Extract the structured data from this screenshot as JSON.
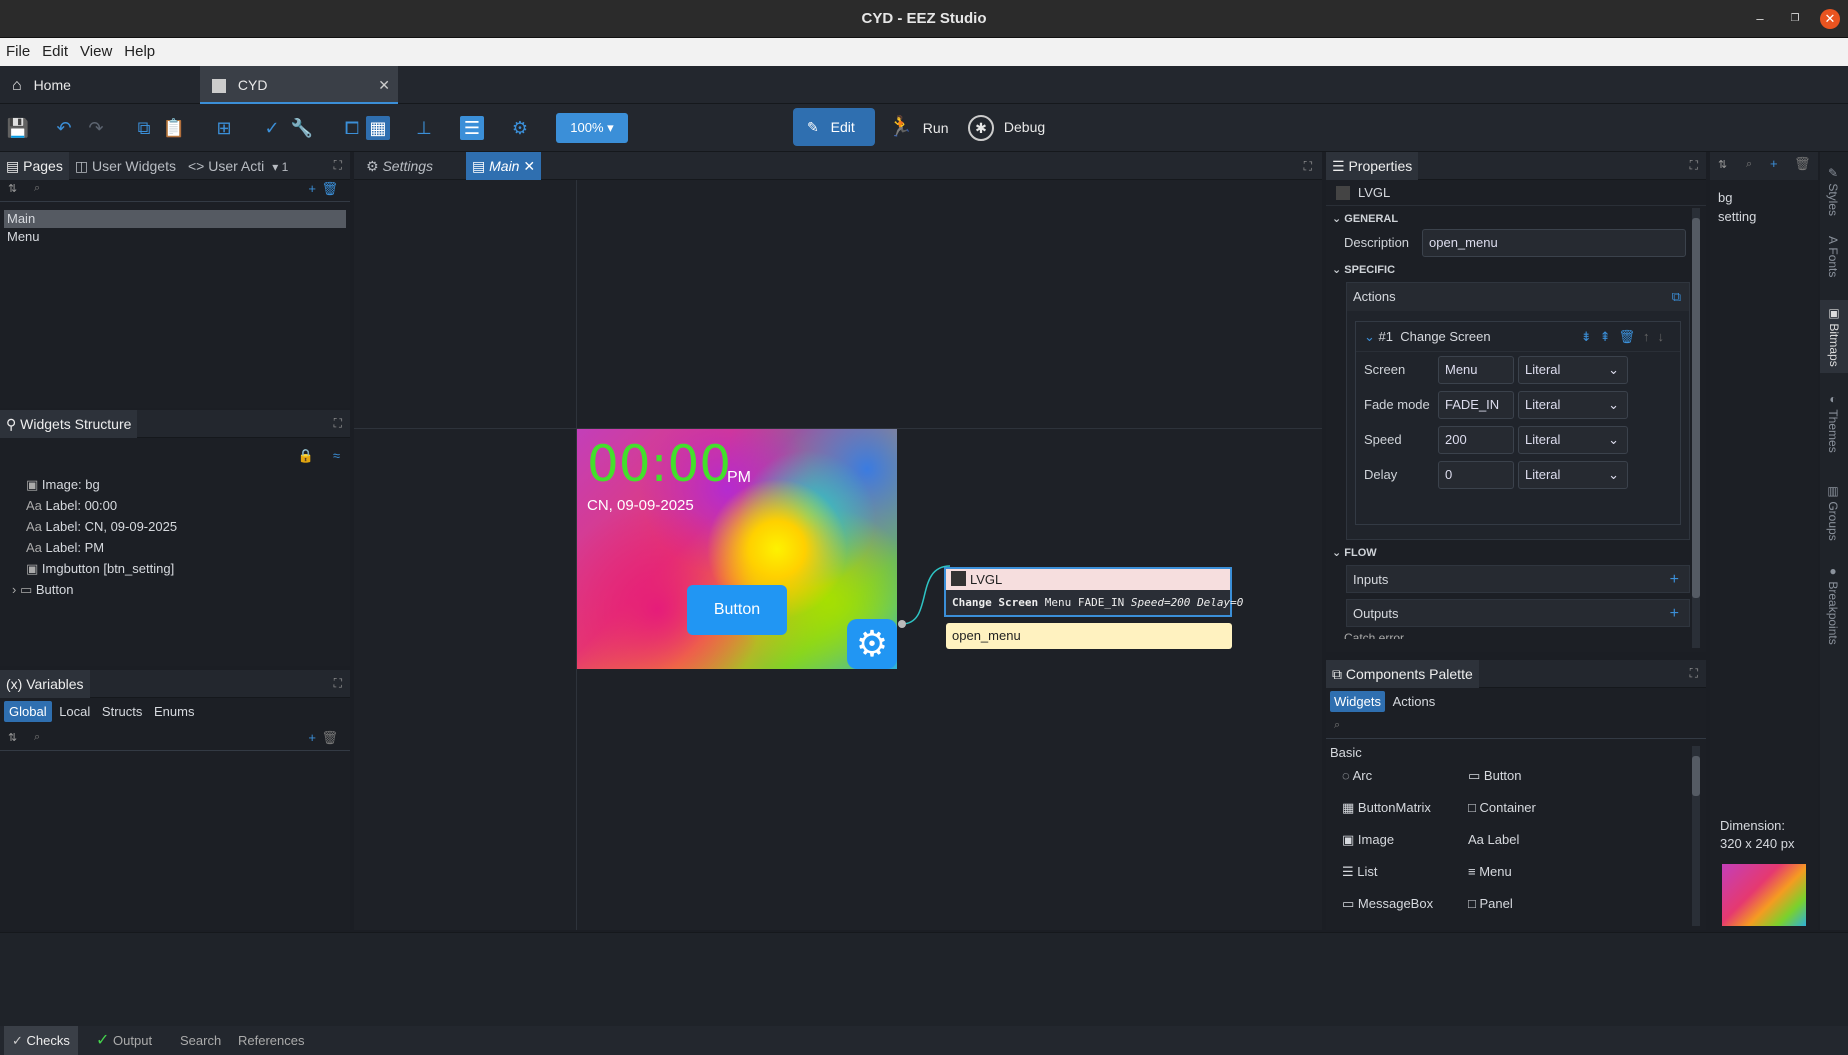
{
  "window": {
    "title": "CYD - EEZ Studio"
  },
  "menu": [
    "File",
    "Edit",
    "View",
    "Help"
  ],
  "tabs": {
    "home": "Home",
    "project": "CYD"
  },
  "toolbar": {
    "zoom": "100%",
    "edit": "Edit",
    "run": "Run",
    "debug": "Debug"
  },
  "left": {
    "tabs": [
      "Pages",
      "User Widgets",
      "User Acti"
    ],
    "tab_count": "1",
    "pages": [
      "Main",
      "Menu"
    ],
    "widgets_title": "Widgets Structure",
    "widgets": [
      "Image: bg",
      "Label: 00:00",
      "Label: CN, 09-09-2025",
      "Label: PM",
      "Imgbutton [btn_setting]",
      "Button"
    ],
    "vars_title": "Variables",
    "vars_prefix": "(x)",
    "vars_tabs": [
      "Global",
      "Local",
      "Structs",
      "Enums"
    ]
  },
  "editor": {
    "tabs": [
      "Settings",
      "Main"
    ],
    "screen": {
      "time": "00:00",
      "ampm": "PM",
      "date": "CN, 09-09-2025",
      "button": "Button"
    },
    "node": {
      "title": "LVGL",
      "body_bold": "Change Screen",
      "body_rest": "Menu FADE_IN",
      "speed": "Speed=200",
      "delay": "Delay=0",
      "description": "open_menu"
    }
  },
  "props": {
    "title": "Properties",
    "object": "LVGL",
    "general": "GENERAL",
    "description_label": "Description",
    "description": "open_menu",
    "specific": "SPECIFIC",
    "actions": "Actions",
    "action_num": "#1",
    "action_name": "Change Screen",
    "fields": [
      {
        "label": "Screen",
        "value": "Menu",
        "mode": "Literal"
      },
      {
        "label": "Fade mode",
        "value": "FADE_IN",
        "mode": "Literal"
      },
      {
        "label": "Speed",
        "value": "200",
        "mode": "Literal"
      },
      {
        "label": "Delay",
        "value": "0",
        "mode": "Literal"
      }
    ],
    "flow": "FLOW",
    "inputs": "Inputs",
    "outputs": "Outputs",
    "catch": "Catch error"
  },
  "palette": {
    "title": "Components Palette",
    "tabs": [
      "Widgets",
      "Actions"
    ],
    "section": "Basic",
    "items": [
      "Arc",
      "Button",
      "ButtonMatrix",
      "Container",
      "Image",
      "Label",
      "List",
      "Menu",
      "MessageBox",
      "Panel"
    ]
  },
  "bitmaps": {
    "items": [
      "bg",
      "setting"
    ],
    "dimension_label": "Dimension:",
    "dimension": "320 x 240 px"
  },
  "vtabs": [
    "Styles",
    "Fonts",
    "Bitmaps",
    "Themes",
    "Groups",
    "Breakpoints"
  ],
  "bottom": [
    "Checks",
    "Output",
    "Search",
    "References"
  ]
}
